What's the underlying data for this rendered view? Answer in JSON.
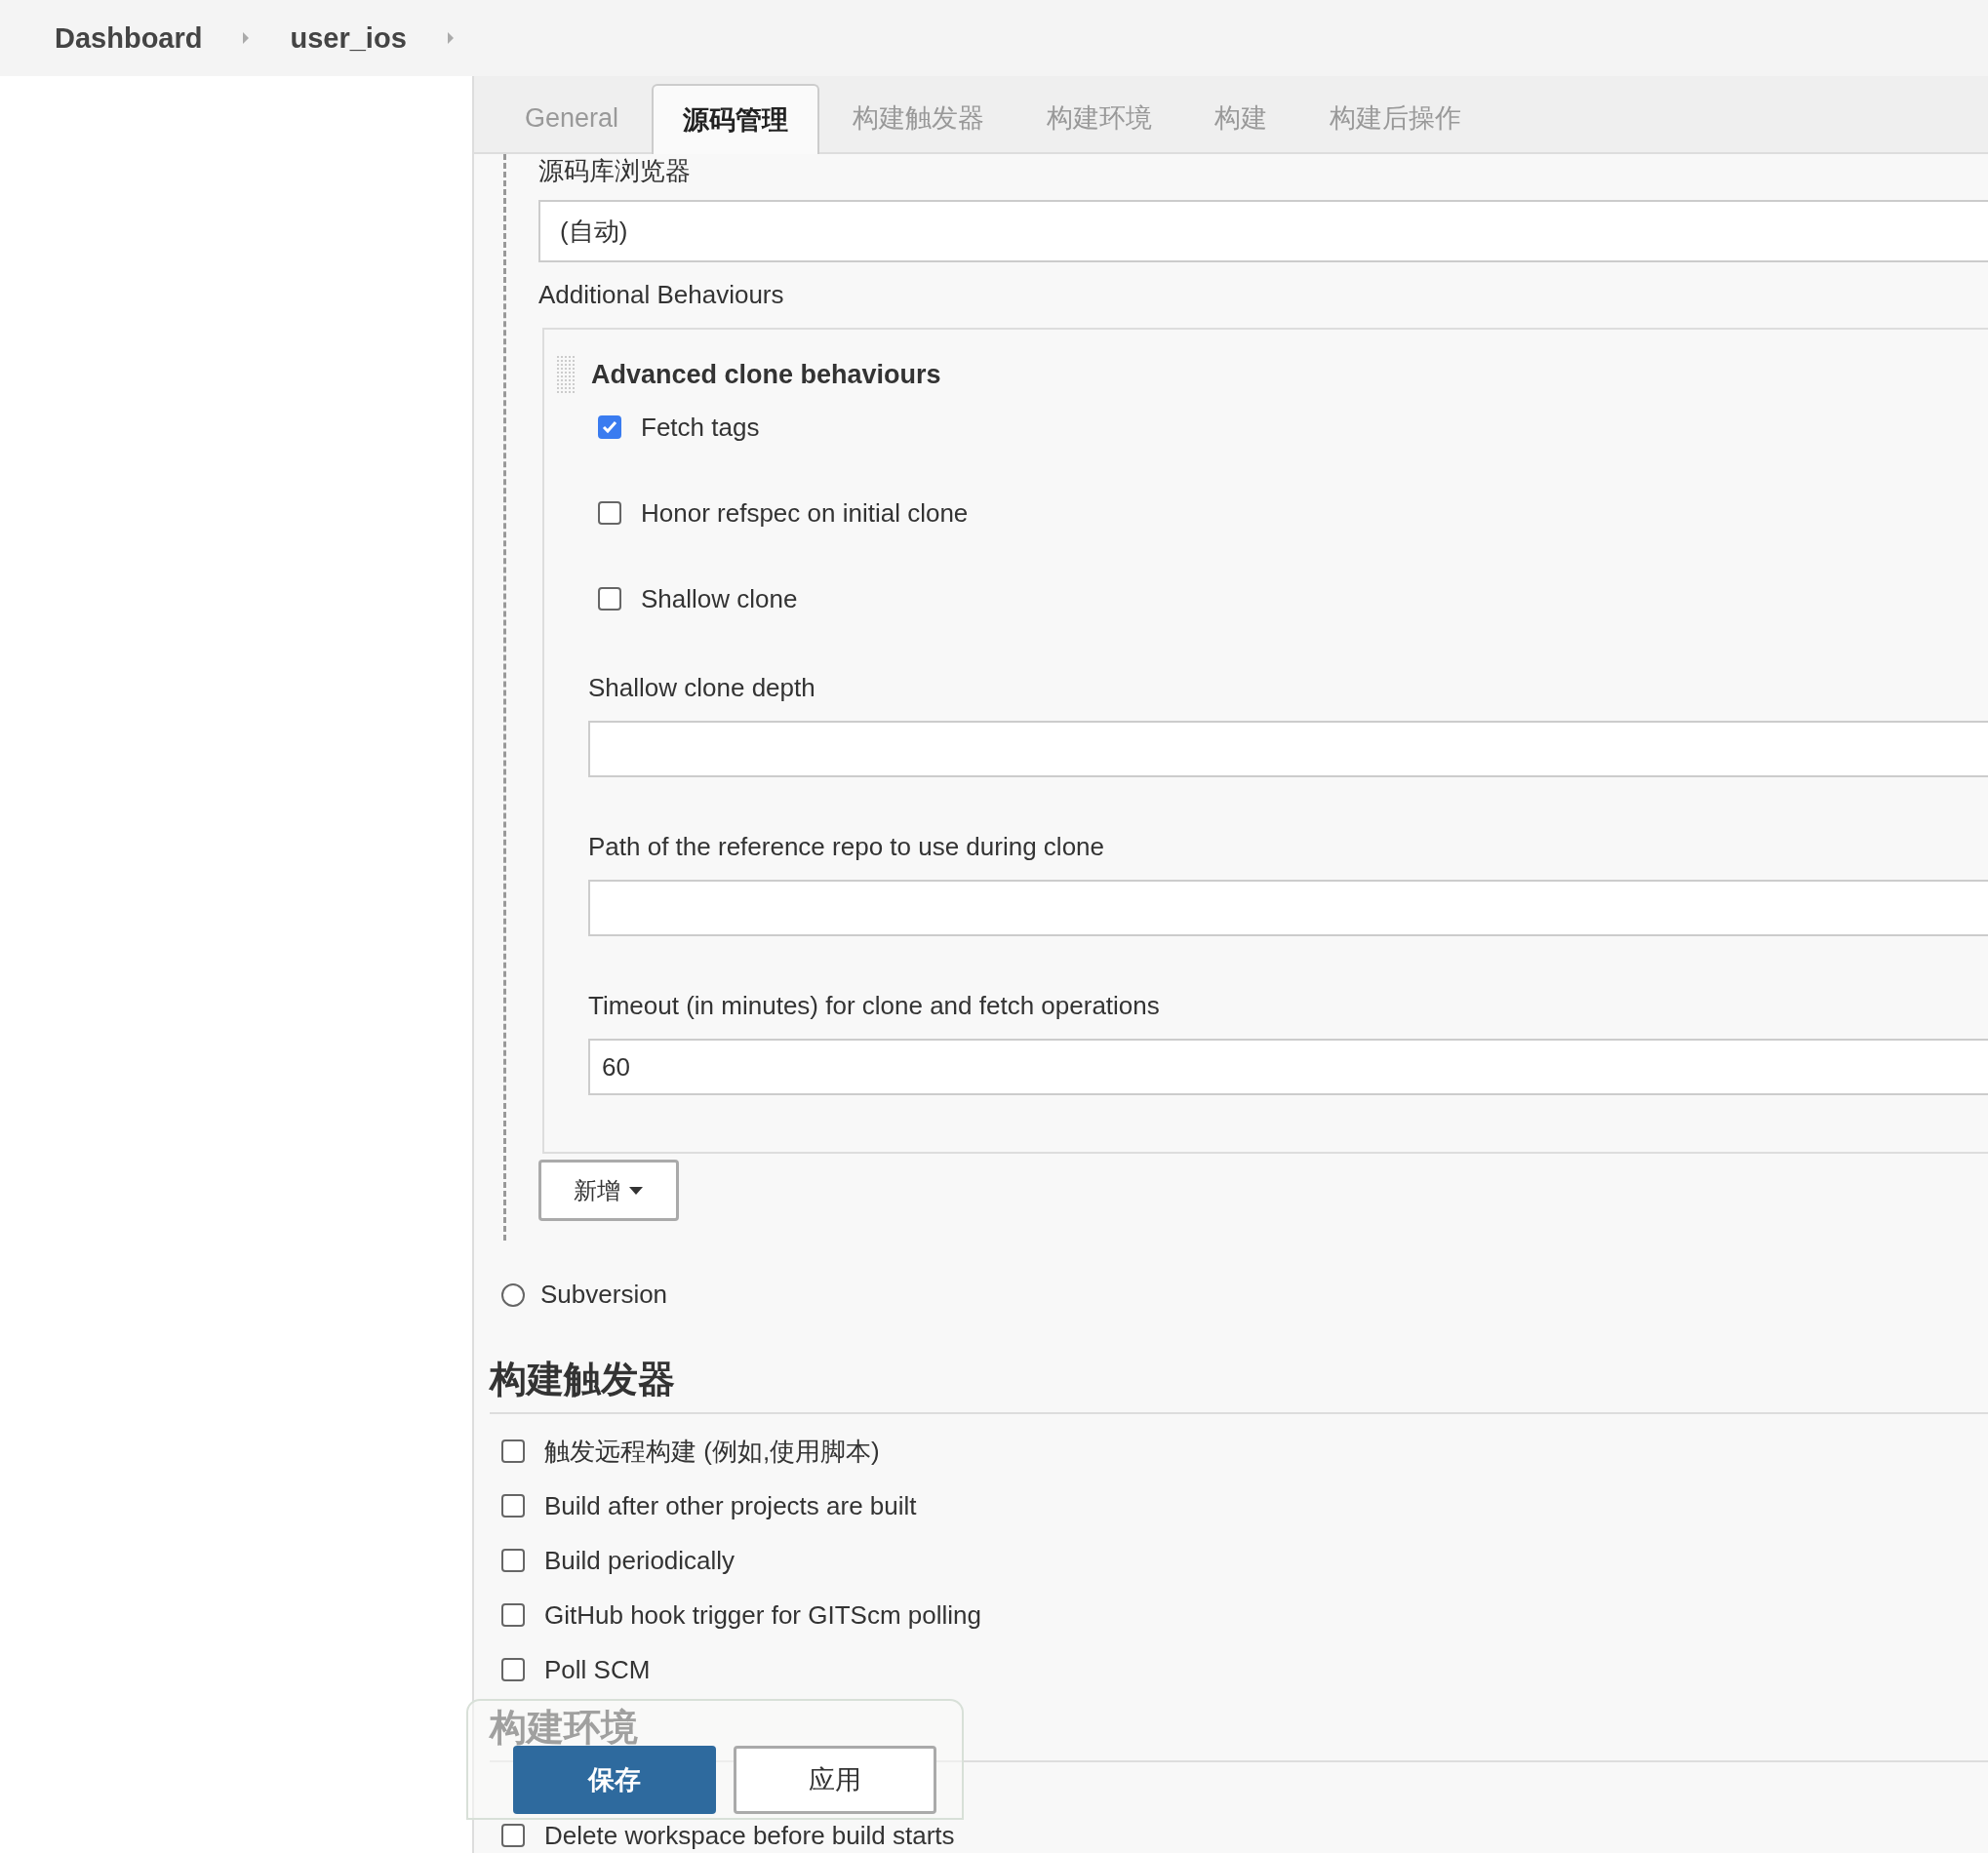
{
  "breadcrumbs": [
    {
      "label": "Dashboard"
    },
    {
      "label": "user_ios"
    }
  ],
  "tabs": [
    {
      "label": "General",
      "selected": false
    },
    {
      "label": "源码管理",
      "selected": true
    },
    {
      "label": "构建触发器",
      "selected": false
    },
    {
      "label": "构建环境",
      "selected": false
    },
    {
      "label": "构建",
      "selected": false
    },
    {
      "label": "构建后操作",
      "selected": false
    }
  ],
  "scm": {
    "browser_label": "源码库浏览器",
    "browser_value": "(自动)",
    "behaviours_label": "Additional Behaviours",
    "behaviour": {
      "title": "Advanced clone behaviours",
      "options": [
        {
          "label": "Fetch tags",
          "checked": true
        },
        {
          "label": "Honor refspec on initial clone",
          "checked": false
        },
        {
          "label": "Shallow clone",
          "checked": false
        }
      ],
      "fields": [
        {
          "label": "Shallow clone depth"
        },
        {
          "label": "Path of the reference repo to use during clone"
        },
        {
          "label": "Timeout (in minutes) for clone and fetch operations",
          "value": "60"
        }
      ]
    },
    "add_button": "新增",
    "radios": [
      {
        "label": "Subversion",
        "selected": false
      }
    ]
  },
  "sections": [
    {
      "title": "构建触发器",
      "options": [
        {
          "label": "触发远程构建 (例如,使用脚本)",
          "checked": false
        },
        {
          "label": "Build after other projects are built",
          "checked": false
        },
        {
          "label": "Build periodically",
          "checked": false
        },
        {
          "label": "GitHub hook trigger for GITScm polling",
          "checked": false
        },
        {
          "label": "Poll SCM",
          "checked": false
        }
      ]
    },
    {
      "title": "构建环境",
      "options": [
        {
          "label": "Delete workspace before build starts",
          "checked": false
        }
      ]
    }
  ],
  "actions": [
    {
      "label": "保存",
      "kind": "primary"
    },
    {
      "label": "应用",
      "kind": "secondary"
    }
  ]
}
